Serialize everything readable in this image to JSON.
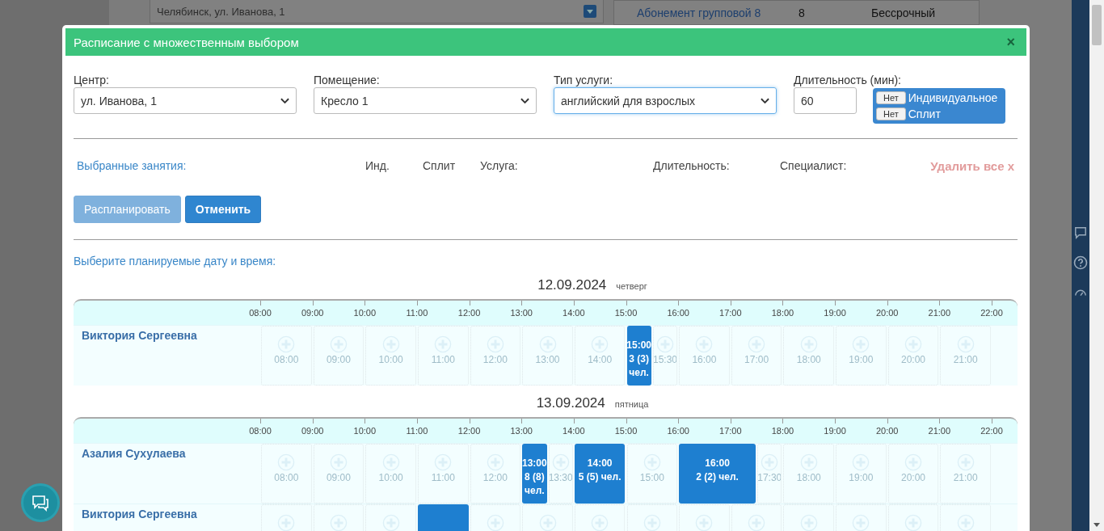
{
  "background_page": {
    "address_field": "Челябинск, ул. Иванова, 1",
    "subscription": {
      "name": "Абонемент групповой 8",
      "count": "8",
      "term": "Бессрочный"
    }
  },
  "modal": {
    "title": "Расписание с множественным выбором",
    "close": "×",
    "fields": [
      {
        "label": "Центр:",
        "kind": "select",
        "value": "ул. Иванова, 1",
        "focused": false
      },
      {
        "label": "Помещение:",
        "kind": "select",
        "value": "Кресло 1",
        "focused": false
      },
      {
        "label": "Тип услуги:",
        "kind": "select",
        "value": "английский для взрослых",
        "focused": true
      },
      {
        "label": "Длительность (мин):",
        "kind": "input",
        "value": "60",
        "focused": false
      }
    ],
    "toggles": [
      {
        "button": "Нет",
        "label": "Индивидуальное"
      },
      {
        "button": "Нет",
        "label": "Сплит"
      }
    ],
    "selected": {
      "title": "Выбранные занятия:",
      "columns": [
        "Инд.",
        "Сплит",
        "Услуга:",
        "Длительность:",
        "Специалист:"
      ],
      "clear": "Удалить все x"
    },
    "buttons": [
      {
        "label": "Распланировать",
        "disabled": true
      },
      {
        "label": "Отменить",
        "disabled": false
      }
    ],
    "prompt": "Выберите планируемые дату и время:",
    "days": [
      {
        "date": "12.09.2024",
        "weekday": "четверг",
        "hours": [
          "08:00",
          "09:00",
          "10:00",
          "11:00",
          "12:00",
          "13:00",
          "14:00",
          "15:00",
          "16:00",
          "17:00",
          "18:00",
          "19:00",
          "20:00",
          "21:00",
          "22:00"
        ],
        "rows": [
          {
            "name": "Виктория Сергеевна",
            "cells": [
              {
                "kind": "slot",
                "time": "08:00"
              },
              {
                "kind": "slot",
                "time": "09:00"
              },
              {
                "kind": "slot",
                "time": "10:00"
              },
              {
                "kind": "slot",
                "time": "11:00"
              },
              {
                "kind": "slot",
                "time": "12:00"
              },
              {
                "kind": "slot",
                "time": "13:00"
              },
              {
                "kind": "slot",
                "time": "14:00"
              },
              {
                "kind": "booking",
                "time": "15:00",
                "count": "3 (3) чел."
              },
              {
                "kind": "slot",
                "time": "15:30"
              },
              {
                "kind": "slot",
                "time": "16:00"
              },
              {
                "kind": "slot",
                "time": "17:00"
              },
              {
                "kind": "slot",
                "time": "18:00"
              },
              {
                "kind": "slot",
                "time": "19:00"
              },
              {
                "kind": "slot",
                "time": "20:00"
              },
              {
                "kind": "slot",
                "time": "21:00"
              }
            ]
          }
        ]
      },
      {
        "date": "13.09.2024",
        "weekday": "пятница",
        "hours": [
          "08:00",
          "09:00",
          "10:00",
          "11:00",
          "12:00",
          "13:00",
          "14:00",
          "15:00",
          "16:00",
          "17:00",
          "18:00",
          "19:00",
          "20:00",
          "21:00",
          "22:00"
        ],
        "rows": [
          {
            "name": "Азалия Сухулаева",
            "cells": [
              {
                "kind": "slot",
                "time": "08:00"
              },
              {
                "kind": "slot",
                "time": "09:00"
              },
              {
                "kind": "slot",
                "time": "10:00"
              },
              {
                "kind": "slot",
                "time": "11:00"
              },
              {
                "kind": "slot",
                "time": "12:00"
              },
              {
                "kind": "booking",
                "time": "13:00",
                "count": "8 (8) чел."
              },
              {
                "kind": "slot",
                "time": "13:30"
              },
              {
                "kind": "booking",
                "time": "14:00",
                "count": "5 (5) чел."
              },
              {
                "kind": "slot",
                "time": "15:00"
              },
              {
                "kind": "booking",
                "time": "16:00",
                "count": "2 (2) чел."
              },
              {
                "kind": "slot",
                "time": "17:30"
              },
              {
                "kind": "slot",
                "time": "18:00"
              },
              {
                "kind": "slot",
                "time": "19:00"
              },
              {
                "kind": "slot",
                "time": "20:00"
              },
              {
                "kind": "slot",
                "time": "21:00"
              }
            ]
          },
          {
            "name": "Виктория Сергеевна",
            "cells": [
              {
                "kind": "slot"
              },
              {
                "kind": "slot"
              },
              {
                "kind": "slot"
              },
              {
                "kind": "booking"
              },
              {
                "kind": "slot"
              },
              {
                "kind": "slot"
              },
              {
                "kind": "slot"
              },
              {
                "kind": "slot"
              },
              {
                "kind": "slot"
              },
              {
                "kind": "slot"
              },
              {
                "kind": "slot"
              },
              {
                "kind": "slot"
              },
              {
                "kind": "slot"
              },
              {
                "kind": "slot"
              }
            ]
          }
        ]
      }
    ]
  }
}
